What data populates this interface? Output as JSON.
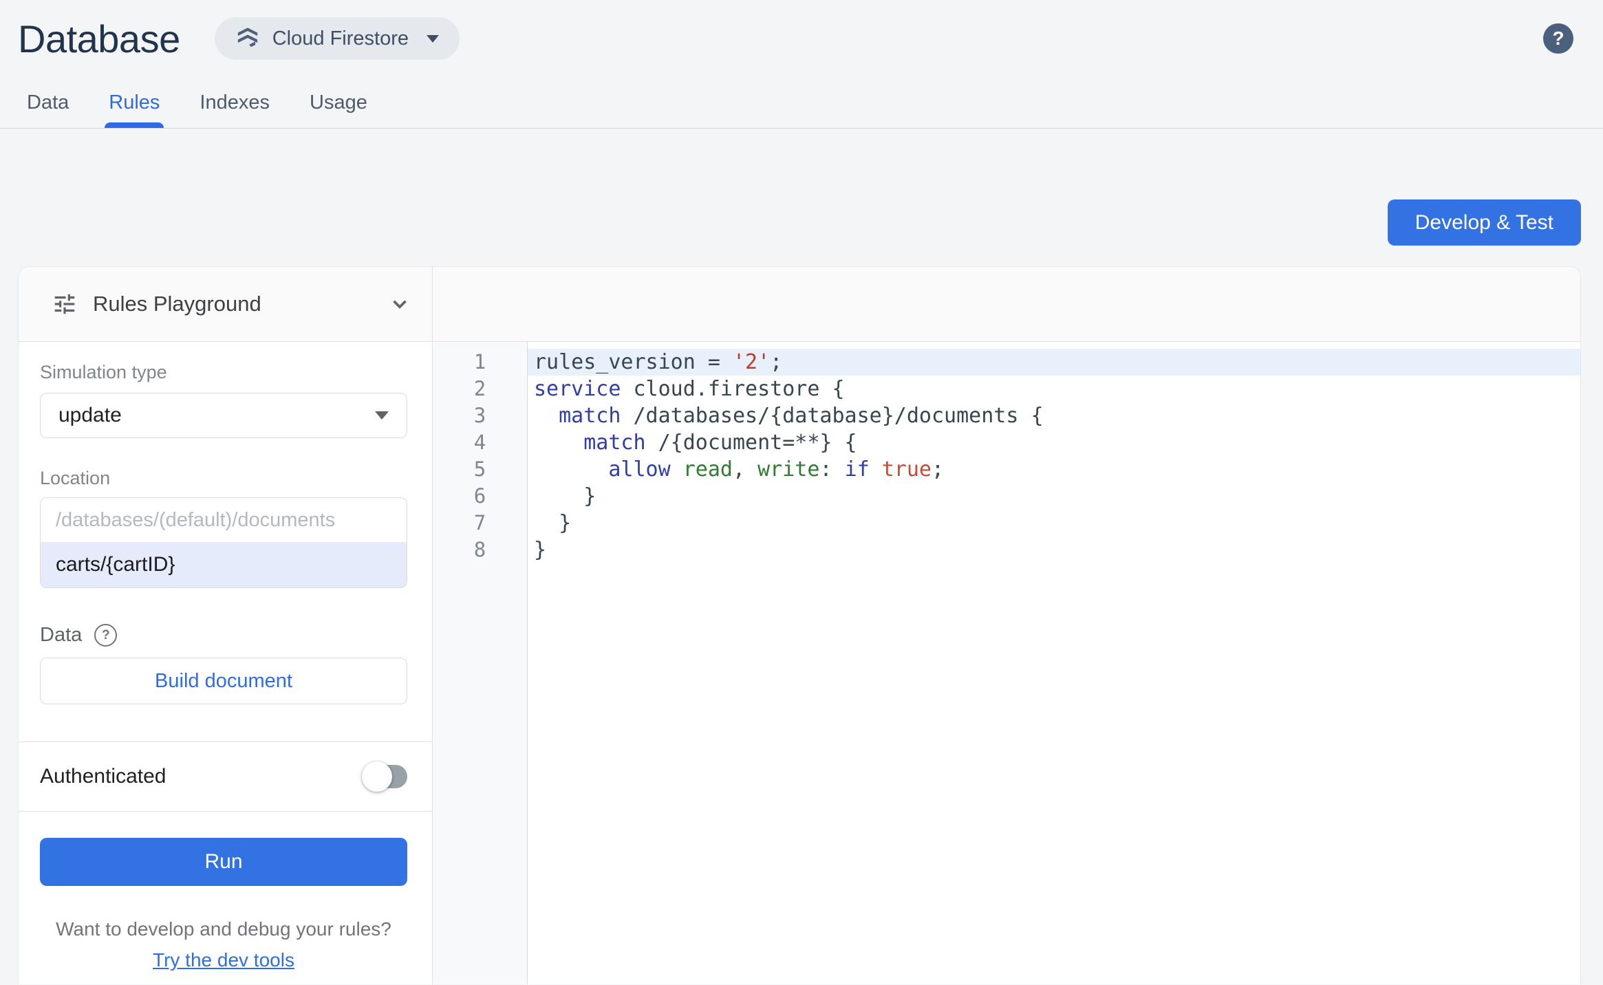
{
  "header": {
    "title": "Database",
    "product": "Cloud Firestore"
  },
  "icons": {
    "help_glyph": "?"
  },
  "tabs": [
    {
      "label": "Data",
      "active": false
    },
    {
      "label": "Rules",
      "active": true
    },
    {
      "label": "Indexes",
      "active": false
    },
    {
      "label": "Usage",
      "active": false
    }
  ],
  "develop_test_button": "Develop & Test",
  "playground": {
    "title": "Rules Playground",
    "simulation_type_label": "Simulation type",
    "simulation_type_value": "update",
    "location_label": "Location",
    "location_prefix": "/databases/(default)/documents",
    "location_value": "carts/{cartID}",
    "data_label": "Data",
    "build_document_button": "Build document",
    "authenticated_label": "Authenticated",
    "authenticated_on": false,
    "run_button": "Run",
    "dev_tools_prompt": "Want to develop and debug your rules?",
    "dev_tools_link": "Try the dev tools"
  },
  "editor": {
    "lines": [
      {
        "n": 1,
        "active": true,
        "tokens": [
          {
            "t": "rules_version = ",
            "c": "plain"
          },
          {
            "t": "'2'",
            "c": "string"
          },
          {
            "t": ";",
            "c": "plain"
          }
        ]
      },
      {
        "n": 2,
        "active": false,
        "tokens": [
          {
            "t": "service",
            "c": "keyword"
          },
          {
            "t": " cloud.firestore {",
            "c": "plain"
          }
        ]
      },
      {
        "n": 3,
        "active": false,
        "tokens": [
          {
            "t": "  ",
            "c": "plain"
          },
          {
            "t": "match",
            "c": "keyword"
          },
          {
            "t": " /databases/{database}/documents {",
            "c": "plain"
          }
        ]
      },
      {
        "n": 4,
        "active": false,
        "tokens": [
          {
            "t": "    ",
            "c": "plain"
          },
          {
            "t": "match",
            "c": "keyword"
          },
          {
            "t": " /{document=**} {",
            "c": "plain"
          }
        ]
      },
      {
        "n": 5,
        "active": false,
        "tokens": [
          {
            "t": "      ",
            "c": "plain"
          },
          {
            "t": "allow",
            "c": "keyword"
          },
          {
            "t": " ",
            "c": "plain"
          },
          {
            "t": "read",
            "c": "method"
          },
          {
            "t": ", ",
            "c": "plain"
          },
          {
            "t": "write",
            "c": "method"
          },
          {
            "t": ": ",
            "c": "plain"
          },
          {
            "t": "if",
            "c": "keyword"
          },
          {
            "t": " ",
            "c": "plain"
          },
          {
            "t": "true",
            "c": "bool"
          },
          {
            "t": ";",
            "c": "plain"
          }
        ]
      },
      {
        "n": 6,
        "active": false,
        "tokens": [
          {
            "t": "    }",
            "c": "plain"
          }
        ]
      },
      {
        "n": 7,
        "active": false,
        "tokens": [
          {
            "t": "  }",
            "c": "plain"
          }
        ]
      },
      {
        "n": 8,
        "active": false,
        "tokens": [
          {
            "t": "}",
            "c": "plain"
          }
        ]
      }
    ]
  },
  "colors": {
    "page_bg": "#f4f5f7",
    "card_bg": "#ffffff",
    "band_bg": "#fafafa",
    "divider": "#e0e2e5",
    "accent_blue": "#3372e3",
    "link_blue": "#2e6ee2",
    "tab_active": "#2e6be2",
    "tab_inactive": "#4d5b6e",
    "title_navy": "#20344d",
    "chip_bg": "#e5e8ed",
    "chip_text": "#3f4f63",
    "help_bg": "#4a607c",
    "label_gray": "#80868b",
    "text_dark": "#202124",
    "placeholder": "#b3b9c0",
    "prompt_gray": "#70757a",
    "input_border": "#dadce0",
    "loc_value_bg": "#e6ebfb",
    "toggle_track": "#98a0a8",
    "gutter_bg": "#f8f9fa",
    "line_number": "#80868b",
    "active_line": "#e8f1fb",
    "tok_plain": "#37474f",
    "tok_keyword": "#2f3ea8",
    "tok_string": "#c03a2c",
    "tok_method": "#2e7d32",
    "tok_bool": "#c44d34"
  }
}
